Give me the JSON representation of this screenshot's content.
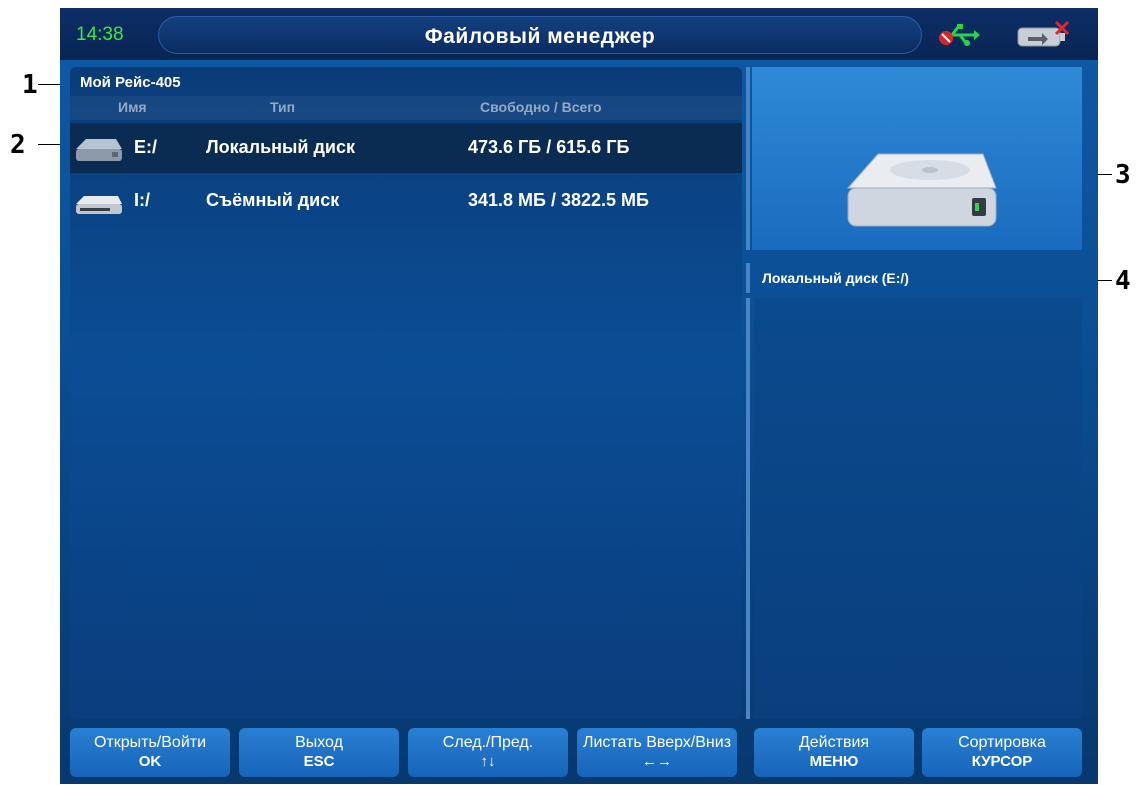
{
  "status": {
    "time": "14:38",
    "title": "Файловый менеджер"
  },
  "icons": {
    "usb": "usb-icon",
    "battery": "battery-disconnected-icon",
    "local_disk": "hard-drive-icon",
    "removable_disk": "removable-drive-icon",
    "disk_preview": "hard-drive-large-icon"
  },
  "left_panel": {
    "title": "Мой Рейс-405",
    "columns": {
      "name": "Имя",
      "type": "Тип",
      "space": "Свободно / Всего"
    },
    "rows": [
      {
        "name": "E:/",
        "type": "Локальный диск",
        "space": "473.6 ГБ / 615.6 ГБ",
        "selected": true
      },
      {
        "name": "I:/",
        "type": "Съёмный диск",
        "space": "341.8 МБ / 3822.5 МБ",
        "selected": false
      }
    ]
  },
  "right_panel": {
    "label": "Локальный диск (E:/)"
  },
  "footer": [
    {
      "label": "Открыть/Войти",
      "key": "OK"
    },
    {
      "label": "Выход",
      "key": "ESC"
    },
    {
      "label": "След./Пред.",
      "key": "↑↓"
    },
    {
      "label": "Листать Вверх/Вниз",
      "key": "←→"
    },
    {
      "label": "Действия",
      "key": "МЕНЮ"
    },
    {
      "label": "Сортировка",
      "key": "КУРСОР"
    }
  ],
  "callouts": [
    "1",
    "2",
    "3",
    "4"
  ],
  "colors": {
    "clock": "#3ee83e",
    "background": "#0b4f95",
    "button": "#1f72c6",
    "selected_row": "#0b2c52"
  }
}
